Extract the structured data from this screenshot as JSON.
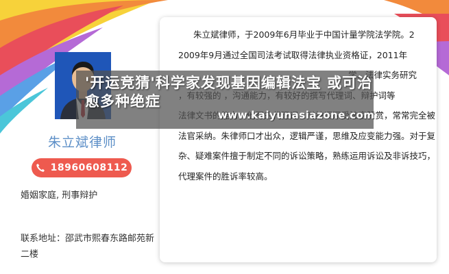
{
  "profile": {
    "name": "朱立斌律师",
    "phone": "18960608112",
    "practice_areas": "婚姻家庭, 刑事辩护",
    "address": "联系地址：邵武市熙春东路邮苑新二楼"
  },
  "bio": {
    "lines": [
      "朱立斌律师，于2009年6月毕业于中国计量学院法学院。2",
      "2009年9月通过全国司法考试取得法律执业资格证，2011年",
      "学、法律实务研究",
      "，有较强的      ，沟通能力，有较好的撰写代理词、辩护词等",
      "法律文书的能力，他写的代理词、辩护词深受法官赞赏，常常完全被",
      "法官采纳。朱律师口才出众，逻辑严谨，思维及应变能力强。对于复",
      "杂、疑难案件擅于制定不同的诉讼策略，熟练运用诉讼及非诉技巧，",
      "代理案件的胜诉率较高。"
    ]
  },
  "overlay": {
    "headline": "'开运竞猜'科学家发现基因编辑法宝 或可治愈多种绝症",
    "watermark": "www.kaiyunasiazone.com"
  },
  "icons": {
    "phone": "phone-icon"
  },
  "colors": {
    "accent": "#ee5a4f",
    "name": "#5d8fc7"
  }
}
